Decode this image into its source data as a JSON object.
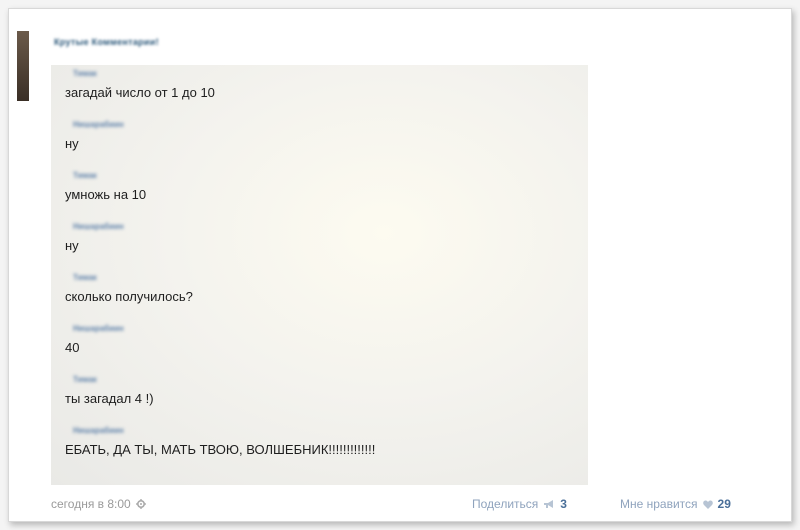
{
  "post": {
    "group_name": "Крутые Комментарии!",
    "timestamp": "сегодня в 8:00",
    "share_label": "Поделиться",
    "share_count": "3",
    "like_label": "Мне нравится",
    "like_count": "29"
  },
  "chat": {
    "messages": [
      {
        "sender": "Тимак",
        "text": "загадай число от 1 до 10"
      },
      {
        "sender": "Нишарабиин",
        "text": "ну"
      },
      {
        "sender": "Тимак",
        "text": "умножь на 10"
      },
      {
        "sender": "Нишарабиин",
        "text": "ну"
      },
      {
        "sender": "Тимак",
        "text": "сколько получилось?"
      },
      {
        "sender": "Нишарабиин",
        "text": "40"
      },
      {
        "sender": "Тимак",
        "text": "ты загадал 4 !)"
      },
      {
        "sender": "Нишарабиин",
        "text": "ЕБАТЬ, ДА ТЫ, МАТЬ ТВОЮ, ВОЛШЕБНИК!!!!!!!!!!!!!"
      }
    ]
  },
  "colors": {
    "link": "#2b587a",
    "muted": "#9a9a9a",
    "counter": "#4a6f99"
  },
  "icons": {
    "settings": "gear-icon",
    "share": "megaphone-icon",
    "like": "heart-icon"
  }
}
